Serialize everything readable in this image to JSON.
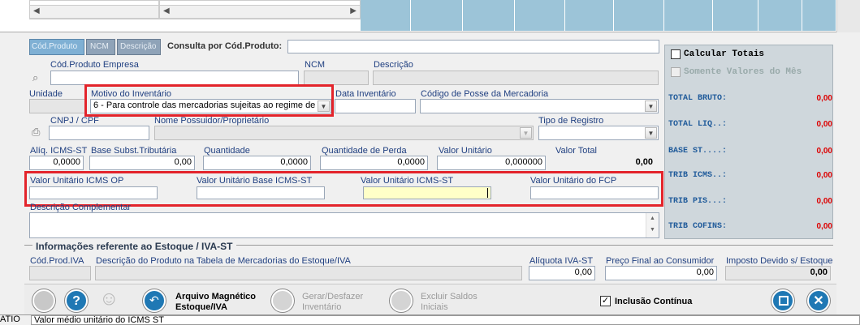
{
  "tabs": [
    "Cód.Produto",
    "NCM",
    "Descrição"
  ],
  "search": {
    "label": "Consulta por Cód.Produto:",
    "value": ""
  },
  "fields": {
    "cod_produto_empresa": {
      "label": "Cód.Produto Empresa",
      "value": ""
    },
    "ncm": {
      "label": "NCM",
      "value": ""
    },
    "descricao": {
      "label": "Descrição",
      "value": ""
    },
    "unidade": {
      "label": "Unidade",
      "value": ""
    },
    "motivo_inventario": {
      "label": "Motivo do Inventário",
      "value": "6 - Para controle das mercadorias sujeitas ao regime de s"
    },
    "data_inventario": {
      "label": "Data Inventário",
      "value": ""
    },
    "codigo_posse": {
      "label": "Código de Posse da Mercadoria",
      "value": ""
    },
    "cnpj_cpf": {
      "label": "CNPJ / CPF",
      "value": ""
    },
    "nome_possuidor": {
      "label": "Nome Possuidor/Proprietário",
      "value": ""
    },
    "tipo_registro": {
      "label": "Tipo de Registro",
      "value": ""
    },
    "aliq_icms_st": {
      "label": "Alíq. ICMS-ST",
      "value": "0,0000"
    },
    "base_subst": {
      "label": "Base Subst.Tributária",
      "value": "0,00"
    },
    "quantidade": {
      "label": "Quantidade",
      "value": "0,0000"
    },
    "quantidade_perda": {
      "label": "Quantidade de Perda",
      "value": "0,0000"
    },
    "valor_unitario": {
      "label": "Valor Unitário",
      "value": "0,000000"
    },
    "valor_total": {
      "label": "Valor Total",
      "value": "0,00"
    },
    "vu_icms_op": {
      "label": "Valor Unitário ICMS OP",
      "value": ""
    },
    "vu_base_icms_st": {
      "label": "Valor Unitário Base ICMS-ST",
      "value": ""
    },
    "vu_icms_st": {
      "label": "Valor Unitário ICMS-ST",
      "value": ""
    },
    "vu_fcp": {
      "label": "Valor Unitário do FCP",
      "value": ""
    },
    "descricao_complementar": {
      "label": "Descrição Complementar",
      "value": ""
    }
  },
  "estoque": {
    "title": "Informações referente ao Estoque / IVA-ST",
    "cod_prod_iva": {
      "label": "Cód.Prod.IVA",
      "value": ""
    },
    "descricao_tabela": {
      "label": "Descrição do Produto na Tabela de Mercadorias do Estoque/IVA",
      "value": ""
    },
    "aliquota_iva_st": {
      "label": "Alíquota IVA-ST",
      "value": "0,00"
    },
    "preco_final": {
      "label": "Preço Final ao Consumidor",
      "value": "0,00"
    },
    "imposto_devido": {
      "label": "Imposto Devido s/ Estoque",
      "value": "0,00"
    }
  },
  "totals": {
    "calcular_label": "Calcular Totais",
    "somente_label": "Somente Valores do Mês",
    "rows": [
      {
        "label": "TOTAL BRUTO:",
        "value": "0,00"
      },
      {
        "label": "TOTAL LIQ..:",
        "value": "0,00"
      },
      {
        "label": "BASE ST....:",
        "value": "0,00"
      },
      {
        "label": "TRIB ICMS..:",
        "value": "0,00"
      },
      {
        "label": "TRIB PIS...:",
        "value": "0,00"
      },
      {
        "label": "TRIB COFINS:",
        "value": "0,00"
      }
    ]
  },
  "toolbar": {
    "arquivo": [
      "Arquivo Magnético",
      "Estoque/IVA"
    ],
    "gerar": [
      "Gerar/Desfazer",
      "Inventário"
    ],
    "excluir": [
      "Excluir Saldos",
      "Iniciais"
    ],
    "inclusao": "Inclusão Contínua"
  },
  "status": {
    "left": "ATIO",
    "message": "Valor médio unitário do ICMS ST"
  },
  "colors": {
    "accent_red": "#e3242b",
    "label_blue": "#1f3f80",
    "highlight_field": "#ffffc8"
  }
}
